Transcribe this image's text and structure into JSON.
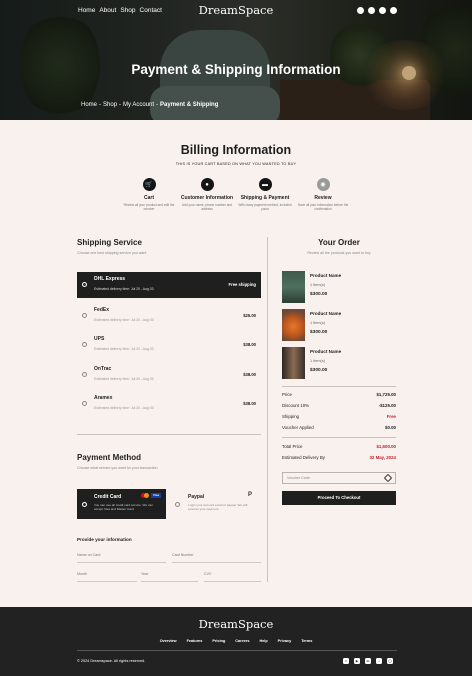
{
  "nav": {
    "links": [
      "Home",
      "About",
      "Shop",
      "Contact"
    ],
    "brand": "DreamSpace",
    "icons": [
      "search-icon",
      "user-icon",
      "heart-icon",
      "cart-icon"
    ]
  },
  "hero": {
    "title": "Payment & Shipping Information",
    "breadcrumb": [
      "Home",
      "Shop",
      "My Account",
      "Payment & Shipping"
    ],
    "breadcrumb_sep": "-"
  },
  "billing": {
    "title": "Billing Information",
    "subtitle": "THIS IS YOUR CART BASED ON WHAT YOU WANTED TO BUY",
    "steps": [
      {
        "label": "Cart",
        "desc": "Review all your product and edit the number",
        "icon": "cart-icon",
        "active": true
      },
      {
        "label": "Customer Information",
        "desc": "Add your name, phone number and address",
        "icon": "user-icon",
        "active": true
      },
      {
        "label": "Shipping & Payment",
        "desc": "With many payment method, included yours",
        "icon": "card-icon",
        "active": true
      },
      {
        "label": "Review",
        "desc": "Have all your information before the confirmation",
        "icon": "review-icon",
        "active": false
      }
    ]
  },
  "shipping": {
    "title": "Shipping Service",
    "subtitle": "Choose one best shipping service you want",
    "options": [
      {
        "name": "DHL Express",
        "date": "Estimated delivery time: Jul 20 - Aug 03",
        "price": "Free shipping",
        "selected": true
      },
      {
        "name": "FedEx",
        "date": "Estimated delivery time: Jul 20 - Aug 03",
        "price": "$25.00",
        "selected": false
      },
      {
        "name": "UPS",
        "date": "Estimated delivery time: Jul 20 - Aug 03",
        "price": "$38.00",
        "selected": false
      },
      {
        "name": "OnTrac",
        "date": "Estimated delivery time: Jul 20 - Aug 03",
        "price": "$38.00",
        "selected": false
      },
      {
        "name": "Aramex",
        "date": "Estimated delivery time: Jul 20 - Aug 03",
        "price": "$38.00",
        "selected": false
      }
    ]
  },
  "payment": {
    "title": "Payment Method",
    "subtitle": "Choose what service you want for your transaction",
    "card": {
      "name": "Credit Card",
      "desc": "You can use all credit card service. We can accept Visa and Master Card",
      "visa": "Visa"
    },
    "paypal": {
      "name": "Paypal",
      "desc": "Login your account email of paypal. We will process your payment",
      "logo": "P"
    },
    "info_title": "Provide your information",
    "fields": {
      "name": "Name on Card",
      "number": "Card Number",
      "month": "Month",
      "year": "Year",
      "cvv": "CVV"
    }
  },
  "order": {
    "title": "Your Order",
    "subtitle": "Review all the products you want to buy",
    "items": [
      {
        "name": "Product Name",
        "qty": "1 Item(s)",
        "price": "$300.00"
      },
      {
        "name": "Product Name",
        "qty": "1 Item(s)",
        "price": "$300.00"
      },
      {
        "name": "Product Name",
        "qty": "1 Item(s)",
        "price": "$300.00"
      }
    ],
    "summary": [
      {
        "label": "Price",
        "value": "$1,725.00",
        "red": false
      },
      {
        "label": "Discount 10%",
        "value": "-$125.00",
        "red": false
      },
      {
        "label": "Shipping",
        "value": "Free",
        "red": true
      },
      {
        "label": "Voucher Applied",
        "value": "$0.00",
        "red": false
      }
    ],
    "total": [
      {
        "label": "Total Price",
        "value": "$1,600.00"
      },
      {
        "label": "Estimated Delivery By",
        "value": "32 May, 2024"
      }
    ],
    "voucher_placeholder": "Voucher Code",
    "checkout_label": "Proceed To Checkout"
  },
  "footer": {
    "brand": "DreamSpace",
    "links": [
      "Overview",
      "Features",
      "Pricing",
      "Careers",
      "Help",
      "Privacy",
      "Terms"
    ],
    "copyright": "© 2024 Dreamspace. All rights reserved.",
    "social": [
      "facebook-icon",
      "youtube-icon",
      "linkedin-icon",
      "tiktok-icon",
      "instagram-icon"
    ]
  },
  "colors": {
    "accent": "#1f1f1f",
    "background": "#f8f1ee",
    "red": "#c4212b",
    "footer": "#222222"
  }
}
